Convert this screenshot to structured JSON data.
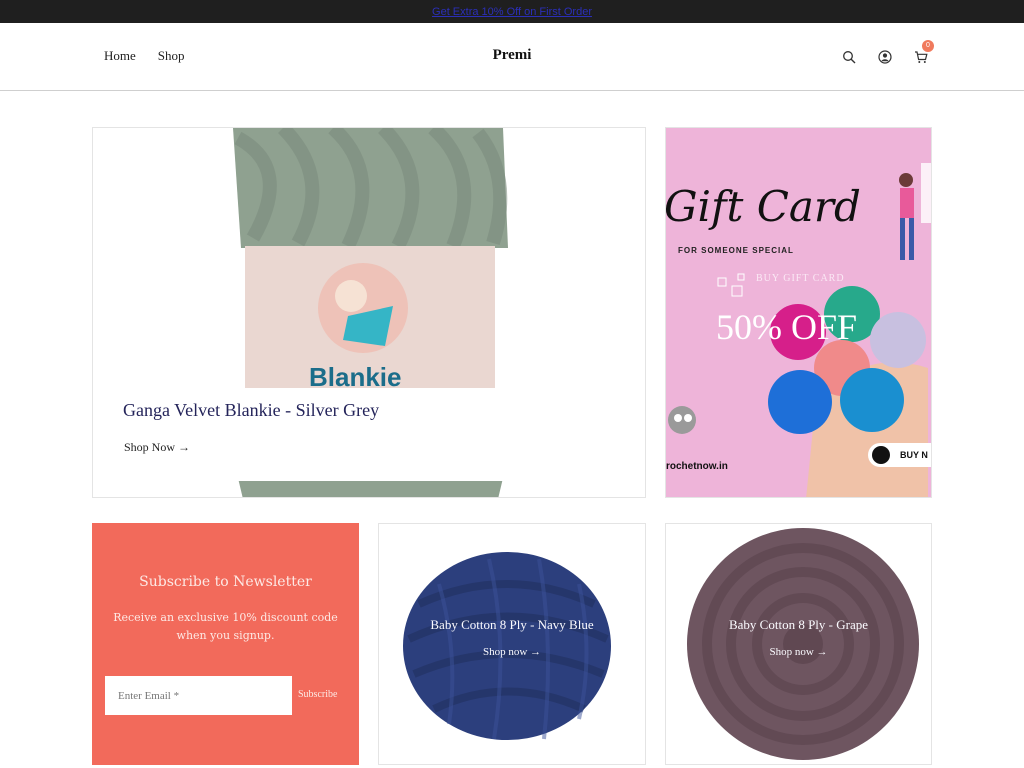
{
  "announcement": {
    "text": "Get Extra 10% Off on First Order"
  },
  "header": {
    "nav": [
      "Home",
      "Shop"
    ],
    "brand": "Premi",
    "icons": [
      "search-icon",
      "account-icon",
      "cart-icon"
    ],
    "cart_count": "0"
  },
  "hero": {
    "title": "Ganga Velvet Blankie - Silver Grey",
    "link": "Shop Now →",
    "image_text": "Blankie"
  },
  "gift_card": {
    "title": "Gift Card",
    "subtitle": "FOR SOMEONE SPECIAL",
    "buy_text": "BUY GIFT CARD",
    "offer": "50% OFF",
    "website": "rochetnow.in",
    "button": "BUY N"
  },
  "newsletter": {
    "title": "Subscribe to Newsletter",
    "text": "Receive an exclusive 10% discount code when you signup.",
    "placeholder": "Enter Email *",
    "button": "Subscribe"
  },
  "products": [
    {
      "title": "Baby Cotton 8 Ply - Navy Blue",
      "link": "Shop now →"
    },
    {
      "title": "Baby Cotton 8 Ply - Grape",
      "link": "Shop now →"
    }
  ],
  "colors": {
    "topbar": "#1f1f1f",
    "accent_coral": "#f26a5b",
    "gift_pink": "#eeb4d9",
    "yarn_grey": "#8fa190",
    "yarn_navy": "#2c3f7d",
    "yarn_grape": "#6e5560"
  }
}
